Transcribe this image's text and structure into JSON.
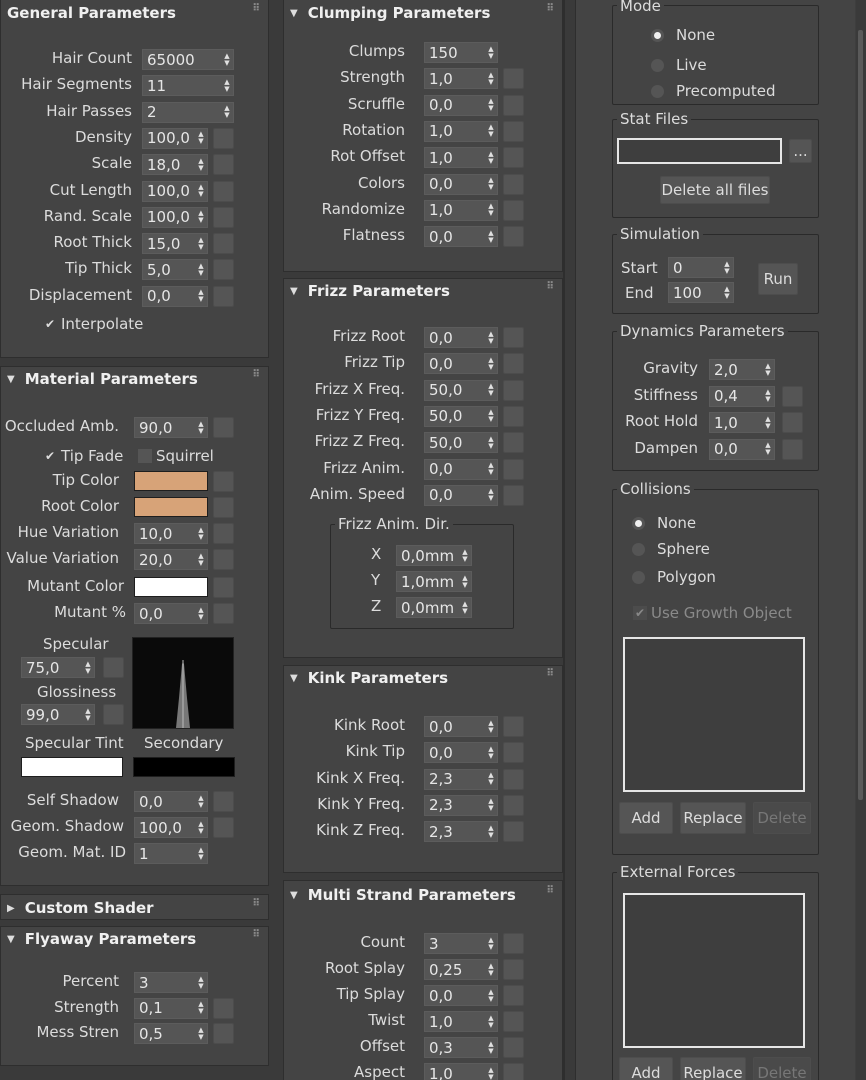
{
  "general": {
    "title": "General Parameters",
    "rows": [
      {
        "label": "Hair Count",
        "value": "65000"
      },
      {
        "label": "Hair Segments",
        "value": "11"
      },
      {
        "label": "Hair Passes",
        "value": "2"
      },
      {
        "label": "Density",
        "value": "100,0"
      },
      {
        "label": "Scale",
        "value": "18,0"
      },
      {
        "label": "Cut Length",
        "value": "100,0"
      },
      {
        "label": "Rand. Scale",
        "value": "100,0"
      },
      {
        "label": "Root Thick",
        "value": "15,0"
      },
      {
        "label": "Tip Thick",
        "value": "5,0"
      },
      {
        "label": "Displacement",
        "value": "0,0"
      }
    ],
    "interpolate": "Interpolate"
  },
  "material": {
    "title": "Material Parameters",
    "occluded_label": "Occluded Amb.",
    "occluded_value": "90,0",
    "tip_fade": "Tip Fade",
    "squirrel": "Squirrel",
    "tip_color_label": "Tip Color",
    "tip_color": "#d7a378",
    "root_color_label": "Root Color",
    "root_color": "#d7a378",
    "hue_label": "Hue Variation",
    "hue_value": "10,0",
    "value_var_label": "Value Variation",
    "value_var_value": "20,0",
    "mutant_color_label": "Mutant Color",
    "mutant_color": "#ffffff",
    "mutant_pct_label": "Mutant %",
    "mutant_pct_value": "0,0",
    "specular_label": "Specular",
    "specular_value": "75,0",
    "gloss_label": "Glossiness",
    "gloss_value": "99,0",
    "spec_tint_label": "Specular Tint",
    "secondary_label": "Secondary",
    "spec_tint_color": "#ffffff",
    "secondary_color": "#000000",
    "self_shadow_label": "Self Shadow",
    "self_shadow_value": "0,0",
    "geom_shadow_label": "Geom. Shadow",
    "geom_shadow_value": "100,0",
    "geom_mat_label": "Geom. Mat. ID",
    "geom_mat_value": "1"
  },
  "custom_shader": {
    "title": "Custom Shader"
  },
  "flyaway": {
    "title": "Flyaway Parameters",
    "rows": [
      {
        "label": "Percent",
        "value": "3"
      },
      {
        "label": "Strength",
        "value": "0,1"
      },
      {
        "label": "Mess Stren",
        "value": "0,5"
      }
    ]
  },
  "clumping": {
    "title": "Clumping Parameters",
    "rows": [
      {
        "label": "Clumps",
        "value": "150"
      },
      {
        "label": "Strength",
        "value": "1,0"
      },
      {
        "label": "Scruffle",
        "value": "0,0"
      },
      {
        "label": "Rotation",
        "value": "1,0"
      },
      {
        "label": "Rot Offset",
        "value": "1,0"
      },
      {
        "label": "Colors",
        "value": "0,0"
      },
      {
        "label": "Randomize",
        "value": "1,0"
      },
      {
        "label": "Flatness",
        "value": "0,0"
      }
    ]
  },
  "frizz": {
    "title": "Frizz Parameters",
    "rows": [
      {
        "label": "Frizz Root",
        "value": "0,0"
      },
      {
        "label": "Frizz Tip",
        "value": "0,0"
      },
      {
        "label": "Frizz X Freq.",
        "value": "50,0"
      },
      {
        "label": "Frizz Y Freq.",
        "value": "50,0"
      },
      {
        "label": "Frizz Z Freq.",
        "value": "50,0"
      },
      {
        "label": "Frizz Anim.",
        "value": "0,0"
      },
      {
        "label": "Anim. Speed",
        "value": "0,0"
      }
    ],
    "dir_title": "Frizz Anim. Dir.",
    "dir": [
      {
        "label": "X",
        "value": "0,0mm"
      },
      {
        "label": "Y",
        "value": "1,0mm"
      },
      {
        "label": "Z",
        "value": "0,0mm"
      }
    ]
  },
  "kink": {
    "title": "Kink Parameters",
    "rows": [
      {
        "label": "Kink Root",
        "value": "0,0"
      },
      {
        "label": "Kink Tip",
        "value": "0,0"
      },
      {
        "label": "Kink X Freq.",
        "value": "2,3"
      },
      {
        "label": "Kink Y Freq.",
        "value": "2,3"
      },
      {
        "label": "Kink Z Freq.",
        "value": "2,3"
      }
    ]
  },
  "multi": {
    "title": "Multi Strand Parameters",
    "rows": [
      {
        "label": "Count",
        "value": "3"
      },
      {
        "label": "Root Splay",
        "value": "0,25"
      },
      {
        "label": "Tip Splay",
        "value": "0,0"
      },
      {
        "label": "Twist",
        "value": "1,0"
      },
      {
        "label": "Offset",
        "value": "0,3"
      },
      {
        "label": "Aspect",
        "value": "1,0"
      }
    ]
  },
  "dynamics": {
    "mode_title": "Mode",
    "modes": [
      "None",
      "Live",
      "Precomputed"
    ],
    "stat_title": "Stat Files",
    "browse": "...",
    "delete_all": "Delete all files",
    "sim_title": "Simulation",
    "start_label": "Start",
    "start_value": "0",
    "end_label": "End",
    "end_value": "100",
    "run": "Run",
    "dyn_title": "Dynamics Parameters",
    "dyn_rows": [
      {
        "label": "Gravity",
        "value": "2,0"
      },
      {
        "label": "Stiffness",
        "value": "0,4"
      },
      {
        "label": "Root Hold",
        "value": "1,0"
      },
      {
        "label": "Dampen",
        "value": "0,0"
      }
    ],
    "coll_title": "Collisions",
    "coll_modes": [
      "None",
      "Sphere",
      "Polygon"
    ],
    "use_growth": "Use Growth Object",
    "add": "Add",
    "replace": "Replace",
    "delete": "Delete",
    "ext_title": "External Forces"
  }
}
